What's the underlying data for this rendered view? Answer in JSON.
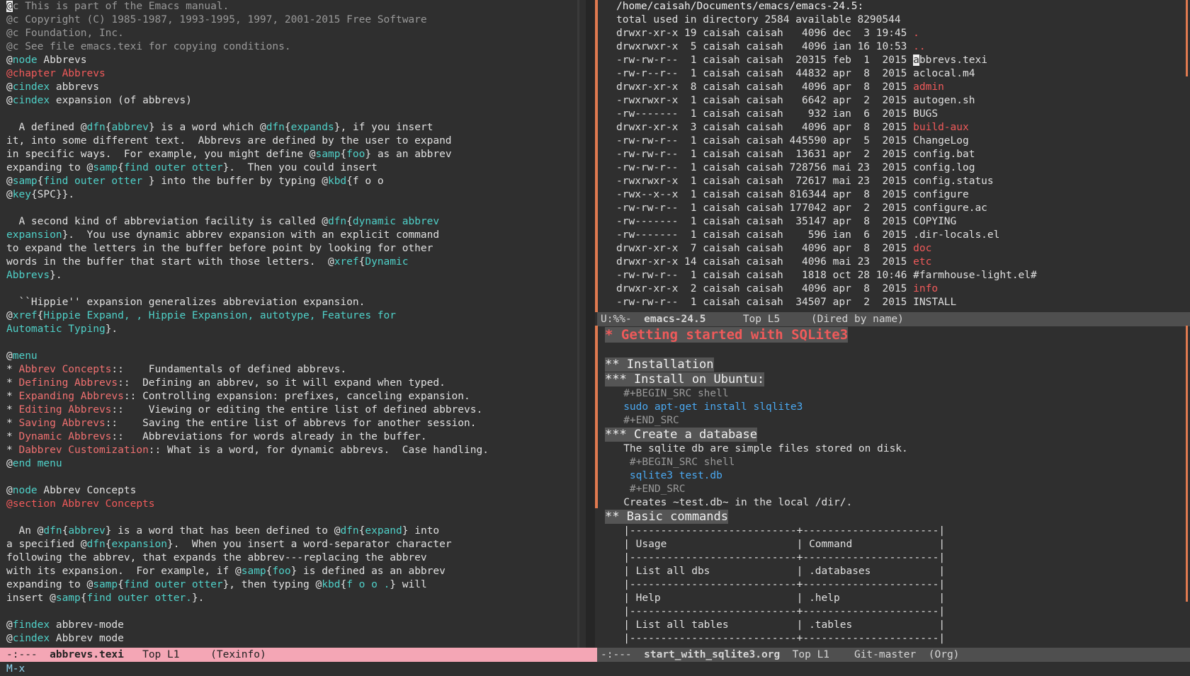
{
  "texinfo": {
    "lines": [
      [
        {
          "c": "cursor",
          "t": "@"
        },
        {
          "c": "cm",
          "t": "c This is part of the Emacs manual."
        }
      ],
      [
        {
          "c": "cm",
          "t": "@c Copyright (C) 1985-1987, 1993-1995, 1997, 2001-2015 Free Software"
        }
      ],
      [
        {
          "c": "cm",
          "t": "@c Foundation, Inc."
        }
      ],
      [
        {
          "c": "cm",
          "t": "@c See file emacs.texi for copying conditions."
        }
      ],
      [
        {
          "c": "cmd",
          "t": "@"
        },
        {
          "c": "kw",
          "t": "node"
        },
        {
          "c": "",
          "t": " Abbrevs"
        }
      ],
      [
        {
          "c": "red",
          "t": "@chapter Abbrevs"
        }
      ],
      [
        {
          "c": "cmd",
          "t": "@"
        },
        {
          "c": "kw",
          "t": "cindex"
        },
        {
          "c": "",
          "t": " abbrevs"
        }
      ],
      [
        {
          "c": "cmd",
          "t": "@"
        },
        {
          "c": "kw",
          "t": "cindex"
        },
        {
          "c": "",
          "t": " expansion (of abbrevs)"
        }
      ],
      [],
      [
        {
          "c": "",
          "t": "  A defined @"
        },
        {
          "c": "kw",
          "t": "dfn"
        },
        {
          "c": "",
          "t": "{"
        },
        {
          "c": "kw",
          "t": "abbrev"
        },
        {
          "c": "",
          "t": "} is a word which @"
        },
        {
          "c": "kw",
          "t": "dfn"
        },
        {
          "c": "",
          "t": "{"
        },
        {
          "c": "kw",
          "t": "expands"
        },
        {
          "c": "",
          "t": "}, if you insert"
        }
      ],
      [
        {
          "c": "",
          "t": "it, into some different text.  Abbrevs are defined by the user to expand"
        }
      ],
      [
        {
          "c": "",
          "t": "in specific ways.  For example, you might define @"
        },
        {
          "c": "kw",
          "t": "samp"
        },
        {
          "c": "",
          "t": "{"
        },
        {
          "c": "kw",
          "t": "foo"
        },
        {
          "c": "",
          "t": "} as an abbrev"
        }
      ],
      [
        {
          "c": "",
          "t": "expanding to @"
        },
        {
          "c": "kw",
          "t": "samp"
        },
        {
          "c": "",
          "t": "{"
        },
        {
          "c": "kw",
          "t": "find outer otter"
        },
        {
          "c": "",
          "t": "}.  Then you could insert"
        }
      ],
      [
        {
          "c": "",
          "t": "@"
        },
        {
          "c": "kw",
          "t": "samp"
        },
        {
          "c": "",
          "t": "{"
        },
        {
          "c": "kw",
          "t": "find outer otter "
        },
        {
          "c": "",
          "t": "} into the buffer by typing @"
        },
        {
          "c": "kw",
          "t": "kbd"
        },
        {
          "c": "",
          "t": "{f o o"
        }
      ],
      [
        {
          "c": "",
          "t": "@"
        },
        {
          "c": "kw",
          "t": "key"
        },
        {
          "c": "",
          "t": "{SPC}}."
        }
      ],
      [],
      [
        {
          "c": "",
          "t": "  A second kind of abbreviation facility is called @"
        },
        {
          "c": "kw",
          "t": "dfn"
        },
        {
          "c": "",
          "t": "{"
        },
        {
          "c": "kw",
          "t": "dynamic abbrev"
        }
      ],
      [
        {
          "c": "kw",
          "t": "expansion"
        },
        {
          "c": "",
          "t": "}.  You use dynamic abbrev expansion with an explicit command"
        }
      ],
      [
        {
          "c": "",
          "t": "to expand the letters in the buffer before point by looking for other"
        }
      ],
      [
        {
          "c": "",
          "t": "words in the buffer that start with those letters.  @"
        },
        {
          "c": "kw",
          "t": "xref"
        },
        {
          "c": "",
          "t": "{"
        },
        {
          "c": "kw",
          "t": "Dynamic"
        }
      ],
      [
        {
          "c": "kw",
          "t": "Abbrevs"
        },
        {
          "c": "",
          "t": "}."
        }
      ],
      [],
      [
        {
          "c": "",
          "t": "  ``Hippie'' expansion generalizes abbreviation expansion."
        }
      ],
      [
        {
          "c": "",
          "t": "@"
        },
        {
          "c": "kw",
          "t": "xref"
        },
        {
          "c": "",
          "t": "{"
        },
        {
          "c": "kw",
          "t": "Hippie Expand, , Hippie Expansion, autotype, Features for"
        }
      ],
      [
        {
          "c": "kw",
          "t": "Automatic Typing"
        },
        {
          "c": "",
          "t": "}."
        }
      ],
      [],
      [
        {
          "c": "",
          "t": "@"
        },
        {
          "c": "kw",
          "t": "menu"
        }
      ],
      [
        {
          "c": "",
          "t": "* "
        },
        {
          "c": "link",
          "t": "Abbrev Concepts"
        },
        {
          "c": "",
          "t": "::    Fundamentals of defined abbrevs."
        }
      ],
      [
        {
          "c": "",
          "t": "* "
        },
        {
          "c": "link",
          "t": "Defining Abbrevs"
        },
        {
          "c": "",
          "t": "::  Defining an abbrev, so it will expand when typed."
        }
      ],
      [
        {
          "c": "",
          "t": "* "
        },
        {
          "c": "link",
          "t": "Expanding Abbrevs"
        },
        {
          "c": "",
          "t": ":: Controlling expansion: prefixes, canceling expansion."
        }
      ],
      [
        {
          "c": "",
          "t": "* "
        },
        {
          "c": "link",
          "t": "Editing Abbrevs"
        },
        {
          "c": "",
          "t": "::    Viewing or editing the entire list of defined abbrevs."
        }
      ],
      [
        {
          "c": "",
          "t": "* "
        },
        {
          "c": "link",
          "t": "Saving Abbrevs"
        },
        {
          "c": "",
          "t": "::    Saving the entire list of abbrevs for another session."
        }
      ],
      [
        {
          "c": "",
          "t": "* "
        },
        {
          "c": "link",
          "t": "Dynamic Abbrevs"
        },
        {
          "c": "",
          "t": "::   Abbreviations for words already in the buffer."
        }
      ],
      [
        {
          "c": "",
          "t": "* "
        },
        {
          "c": "link",
          "t": "Dabbrev Customization"
        },
        {
          "c": "",
          "t": ":: What is a word, for dynamic abbrevs.  Case handling."
        }
      ],
      [
        {
          "c": "",
          "t": "@"
        },
        {
          "c": "kw",
          "t": "end menu"
        }
      ],
      [],
      [
        {
          "c": "",
          "t": "@"
        },
        {
          "c": "kw",
          "t": "node"
        },
        {
          "c": "",
          "t": " Abbrev Concepts"
        }
      ],
      [
        {
          "c": "red",
          "t": "@section Abbrev Concepts"
        }
      ],
      [],
      [
        {
          "c": "",
          "t": "  An @"
        },
        {
          "c": "kw",
          "t": "dfn"
        },
        {
          "c": "",
          "t": "{"
        },
        {
          "c": "kw",
          "t": "abbrev"
        },
        {
          "c": "",
          "t": "} is a word that has been defined to @"
        },
        {
          "c": "kw",
          "t": "dfn"
        },
        {
          "c": "",
          "t": "{"
        },
        {
          "c": "kw",
          "t": "expand"
        },
        {
          "c": "",
          "t": "} into"
        }
      ],
      [
        {
          "c": "",
          "t": "a specified @"
        },
        {
          "c": "kw",
          "t": "dfn"
        },
        {
          "c": "",
          "t": "{"
        },
        {
          "c": "kw",
          "t": "expansion"
        },
        {
          "c": "",
          "t": "}.  When you insert a word-separator character"
        }
      ],
      [
        {
          "c": "",
          "t": "following the abbrev, that expands the abbrev---replacing the abbrev"
        }
      ],
      [
        {
          "c": "",
          "t": "with its expansion.  For example, if @"
        },
        {
          "c": "kw",
          "t": "samp"
        },
        {
          "c": "",
          "t": "{"
        },
        {
          "c": "kw",
          "t": "foo"
        },
        {
          "c": "",
          "t": "} is defined as an abbrev"
        }
      ],
      [
        {
          "c": "",
          "t": "expanding to @"
        },
        {
          "c": "kw",
          "t": "samp"
        },
        {
          "c": "",
          "t": "{"
        },
        {
          "c": "kw",
          "t": "find outer otter"
        },
        {
          "c": "",
          "t": "}, then typing @"
        },
        {
          "c": "kw",
          "t": "kbd"
        },
        {
          "c": "",
          "t": "{"
        },
        {
          "c": "kw",
          "t": "f o o ."
        },
        {
          "c": "",
          "t": "} will"
        }
      ],
      [
        {
          "c": "",
          "t": "insert @"
        },
        {
          "c": "kw",
          "t": "samp"
        },
        {
          "c": "",
          "t": "{"
        },
        {
          "c": "kw",
          "t": "find outer otter."
        },
        {
          "c": "",
          "t": "}."
        }
      ],
      [],
      [
        {
          "c": "",
          "t": "@"
        },
        {
          "c": "kw",
          "t": "findex"
        },
        {
          "c": "",
          "t": " abbrev-mode"
        }
      ],
      [
        {
          "c": "",
          "t": "@"
        },
        {
          "c": "kw",
          "t": "cindex"
        },
        {
          "c": "",
          "t": " Abbrev mode"
        }
      ]
    ]
  },
  "dired": {
    "header": "/home/caisah/Documents/emacs/emacs-24.5:",
    "total": "total used in directory 2584 available 8290544",
    "rows": [
      {
        "perm": "drwxr-xr-x",
        "n": "19",
        "user": "caisah",
        "group": "caisah",
        "size": "4096",
        "mon": "dec",
        "day": "3",
        "time": "19:45",
        "name": ".",
        "dir": true
      },
      {
        "perm": "drwxrwxr-x",
        "n": "5",
        "user": "caisah",
        "group": "caisah",
        "size": "4096",
        "mon": "ian",
        "day": "16",
        "time": "10:53",
        "name": "..",
        "dir": true
      },
      {
        "perm": "-rw-rw-r--",
        "n": "1",
        "user": "caisah",
        "group": "caisah",
        "size": "20315",
        "mon": "feb",
        "day": "1",
        "time": "2015",
        "name": "abbrevs.texi",
        "dir": false,
        "cursor": true
      },
      {
        "perm": "-rw-r--r--",
        "n": "1",
        "user": "caisah",
        "group": "caisah",
        "size": "44832",
        "mon": "apr",
        "day": "8",
        "time": "2015",
        "name": "aclocal.m4",
        "dir": false
      },
      {
        "perm": "drwxr-xr-x",
        "n": "8",
        "user": "caisah",
        "group": "caisah",
        "size": "4096",
        "mon": "apr",
        "day": "8",
        "time": "2015",
        "name": "admin",
        "dir": true
      },
      {
        "perm": "-rwxrwxr-x",
        "n": "1",
        "user": "caisah",
        "group": "caisah",
        "size": "6642",
        "mon": "apr",
        "day": "2",
        "time": "2015",
        "name": "autogen.sh",
        "dir": false
      },
      {
        "perm": "-rw-------",
        "n": "1",
        "user": "caisah",
        "group": "caisah",
        "size": "932",
        "mon": "ian",
        "day": "6",
        "time": "2015",
        "name": "BUGS",
        "dir": false
      },
      {
        "perm": "drwxr-xr-x",
        "n": "3",
        "user": "caisah",
        "group": "caisah",
        "size": "4096",
        "mon": "apr",
        "day": "8",
        "time": "2015",
        "name": "build-aux",
        "dir": true
      },
      {
        "perm": "-rw-rw-r--",
        "n": "1",
        "user": "caisah",
        "group": "caisah",
        "size": "445590",
        "mon": "apr",
        "day": "5",
        "time": "2015",
        "name": "ChangeLog",
        "dir": false
      },
      {
        "perm": "-rw-rw-r--",
        "n": "1",
        "user": "caisah",
        "group": "caisah",
        "size": "13631",
        "mon": "apr",
        "day": "2",
        "time": "2015",
        "name": "config.bat",
        "dir": false
      },
      {
        "perm": "-rw-rw-r--",
        "n": "1",
        "user": "caisah",
        "group": "caisah",
        "size": "728756",
        "mon": "mai",
        "day": "23",
        "time": "2015",
        "name": "config.log",
        "dir": false
      },
      {
        "perm": "-rwxrwxr-x",
        "n": "1",
        "user": "caisah",
        "group": "caisah",
        "size": "72617",
        "mon": "mai",
        "day": "23",
        "time": "2015",
        "name": "config.status",
        "dir": false
      },
      {
        "perm": "-rwx--x--x",
        "n": "1",
        "user": "caisah",
        "group": "caisah",
        "size": "816344",
        "mon": "apr",
        "day": "8",
        "time": "2015",
        "name": "configure",
        "dir": false
      },
      {
        "perm": "-rw-rw-r--",
        "n": "1",
        "user": "caisah",
        "group": "caisah",
        "size": "177042",
        "mon": "apr",
        "day": "2",
        "time": "2015",
        "name": "configure.ac",
        "dir": false
      },
      {
        "perm": "-rw-------",
        "n": "1",
        "user": "caisah",
        "group": "caisah",
        "size": "35147",
        "mon": "apr",
        "day": "8",
        "time": "2015",
        "name": "COPYING",
        "dir": false
      },
      {
        "perm": "-rw-------",
        "n": "1",
        "user": "caisah",
        "group": "caisah",
        "size": "596",
        "mon": "ian",
        "day": "6",
        "time": "2015",
        "name": ".dir-locals.el",
        "dir": false
      },
      {
        "perm": "drwxr-xr-x",
        "n": "7",
        "user": "caisah",
        "group": "caisah",
        "size": "4096",
        "mon": "apr",
        "day": "8",
        "time": "2015",
        "name": "doc",
        "dir": true
      },
      {
        "perm": "drwxr-xr-x",
        "n": "14",
        "user": "caisah",
        "group": "caisah",
        "size": "4096",
        "mon": "mai",
        "day": "23",
        "time": "2015",
        "name": "etc",
        "dir": true
      },
      {
        "perm": "-rw-rw-r--",
        "n": "1",
        "user": "caisah",
        "group": "caisah",
        "size": "1818",
        "mon": "oct",
        "day": "28",
        "time": "10:46",
        "name": "#farmhouse-light.el#",
        "dir": false
      },
      {
        "perm": "drwxr-xr-x",
        "n": "2",
        "user": "caisah",
        "group": "caisah",
        "size": "4096",
        "mon": "apr",
        "day": "8",
        "time": "2015",
        "name": "info",
        "dir": true
      },
      {
        "perm": "-rw-rw-r--",
        "n": "1",
        "user": "caisah",
        "group": "caisah",
        "size": "34507",
        "mon": "apr",
        "day": "2",
        "time": "2015",
        "name": "INSTALL",
        "dir": false
      }
    ]
  },
  "org": {
    "lines": [
      {
        "k": "h1",
        "t": "* Getting started with SQLite3"
      },
      {
        "k": "blank"
      },
      {
        "k": "h",
        "t": "** Installation"
      },
      {
        "k": "h",
        "t": "*** Install on Ubuntu:"
      },
      {
        "k": "meta",
        "t": "   #+BEGIN_SRC shell"
      },
      {
        "k": "src",
        "t": "   sudo apt-get install slqlite3"
      },
      {
        "k": "meta",
        "t": "   #+END_SRC"
      },
      {
        "k": "h",
        "t": "*** Create a database"
      },
      {
        "k": "text",
        "t": "   The sqlite db are simple files stored on disk."
      },
      {
        "k": "meta",
        "t": "    #+BEGIN_SRC shell"
      },
      {
        "k": "src",
        "t": "    sqlite3 test.db"
      },
      {
        "k": "meta",
        "t": "    #+END_SRC"
      },
      {
        "k": "text",
        "t": "   Creates ~test.db~ in the local /dir/."
      },
      {
        "k": "h",
        "t": "** Basic commands"
      },
      {
        "k": "text",
        "t": "   |---------------------------+----------------------|"
      },
      {
        "k": "text",
        "t": "   | Usage                     | Command              |"
      },
      {
        "k": "text",
        "t": "   |---------------------------+----------------------|"
      },
      {
        "k": "text",
        "t": "   | List all dbs              | .databases           |"
      },
      {
        "k": "text",
        "t": "   |---------------------------+----------------------|"
      },
      {
        "k": "text",
        "t": "   | Help                      | .help                |"
      },
      {
        "k": "text",
        "t": "   |---------------------------+----------------------|"
      },
      {
        "k": "text",
        "t": "   | List all tables           | .tables              |"
      },
      {
        "k": "text",
        "t": "   |---------------------------+----------------------|"
      }
    ]
  },
  "modeline": {
    "left": {
      "status": "-:---",
      "buffer": "abbrevs.texi",
      "pos": "Top L1",
      "mode": "(Texinfo)"
    },
    "dired": {
      "status": "U:%%-",
      "buffer": "emacs-24.5",
      "pos": "Top L5",
      "mode": "(Dired by name)"
    },
    "org": {
      "status": "-:---",
      "buffer": "start_with_sqlite3.org",
      "pos": "Top L1",
      "vc": "Git-master",
      "mode": "(Org)"
    }
  },
  "minibuffer": "M-x"
}
